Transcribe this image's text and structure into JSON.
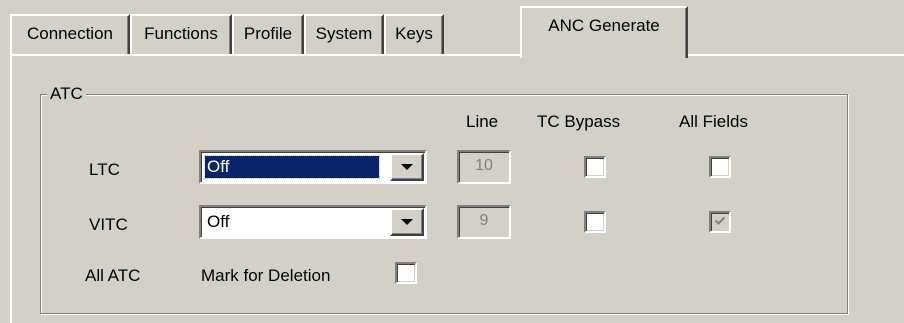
{
  "tabs": [
    {
      "label": "Connection",
      "active": false
    },
    {
      "label": "Functions",
      "active": false
    },
    {
      "label": "Profile",
      "active": false
    },
    {
      "label": "System",
      "active": false
    },
    {
      "label": "Keys",
      "active": false
    },
    {
      "label": "ANC Generate",
      "active": true
    }
  ],
  "group": {
    "title": "ATC",
    "columns": {
      "line": "Line",
      "tc_bypass": "TC Bypass",
      "all_fields": "All Fields"
    },
    "rows": {
      "ltc": {
        "label": "LTC",
        "select_value": "Off",
        "line": "10",
        "tc_bypass": false,
        "all_fields": false
      },
      "vitc": {
        "label": "VITC",
        "select_value": "Off",
        "line": "9",
        "tc_bypass": false,
        "all_fields": true
      }
    },
    "all_atc": {
      "label": "All ATC",
      "mark_label": "Mark for Deletion",
      "checked": false
    }
  }
}
